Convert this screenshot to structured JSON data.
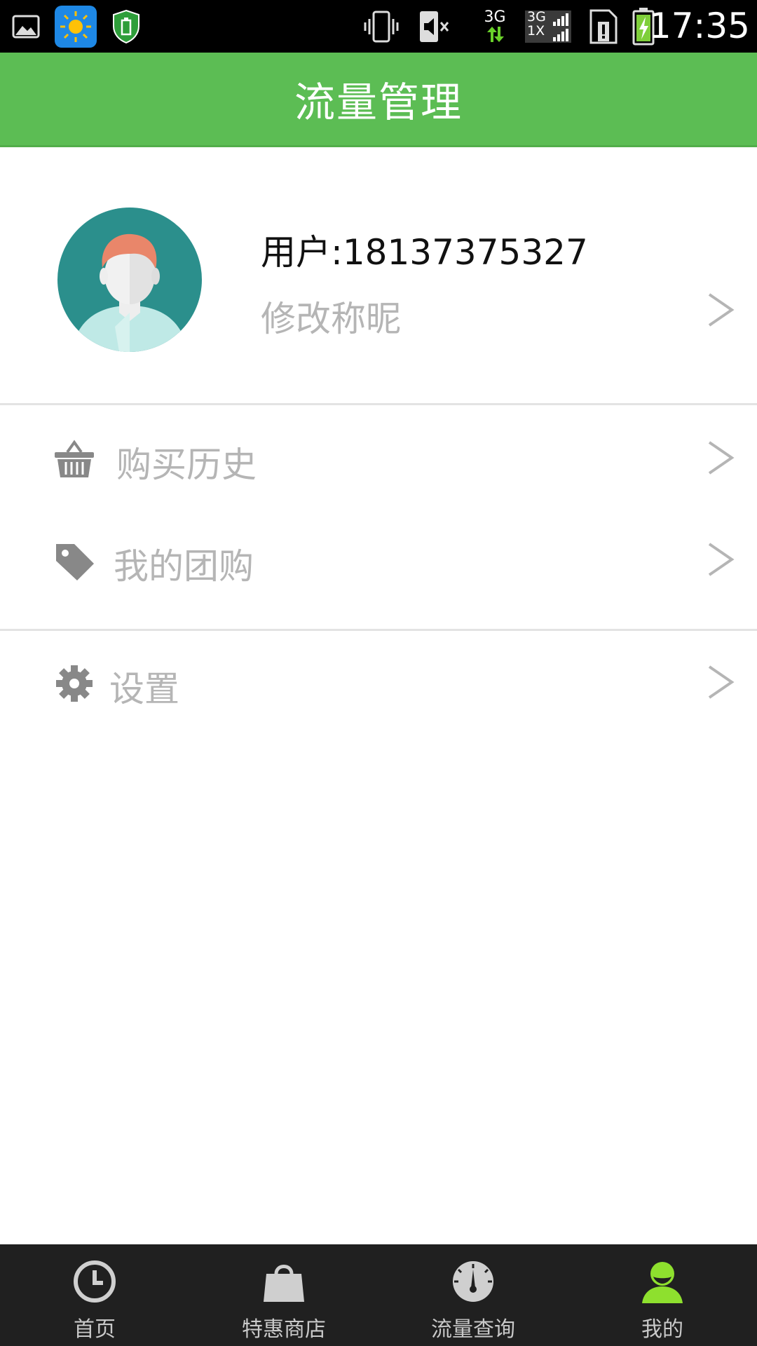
{
  "status_bar": {
    "time": "17:35",
    "network_type": "3G",
    "sim_label_top": "3G",
    "sim_label_bottom": "1X",
    "icons": [
      "gallery-icon",
      "weather-icon",
      "shield-icon",
      "vibrate-icon",
      "mute-icon",
      "data-arrows-icon",
      "signal-icon",
      "sim-alert-icon",
      "battery-charging-icon"
    ]
  },
  "header": {
    "title": "流量管理"
  },
  "profile": {
    "username": "用户:18137375327",
    "edit_nickname": "修改称昵"
  },
  "menu": [
    {
      "label": "购买历史",
      "icon": "basket-icon"
    },
    {
      "label": "我的团购",
      "icon": "tag-icon"
    },
    {
      "label": "设置",
      "icon": "gear-icon"
    }
  ],
  "bottom_nav": [
    {
      "label": "首页",
      "icon": "clock-icon"
    },
    {
      "label": "特惠商店",
      "icon": "shopping-bag-icon"
    },
    {
      "label": "流量查询",
      "icon": "speedometer-icon"
    },
    {
      "label": "我的",
      "icon": "user-icon",
      "active": true
    }
  ],
  "colors": {
    "header_green": "#5cbd54",
    "active_green": "#8ee02e",
    "status_bar": "#000000",
    "nav_bg": "#202020",
    "label_gray": "#b5b5b5"
  }
}
